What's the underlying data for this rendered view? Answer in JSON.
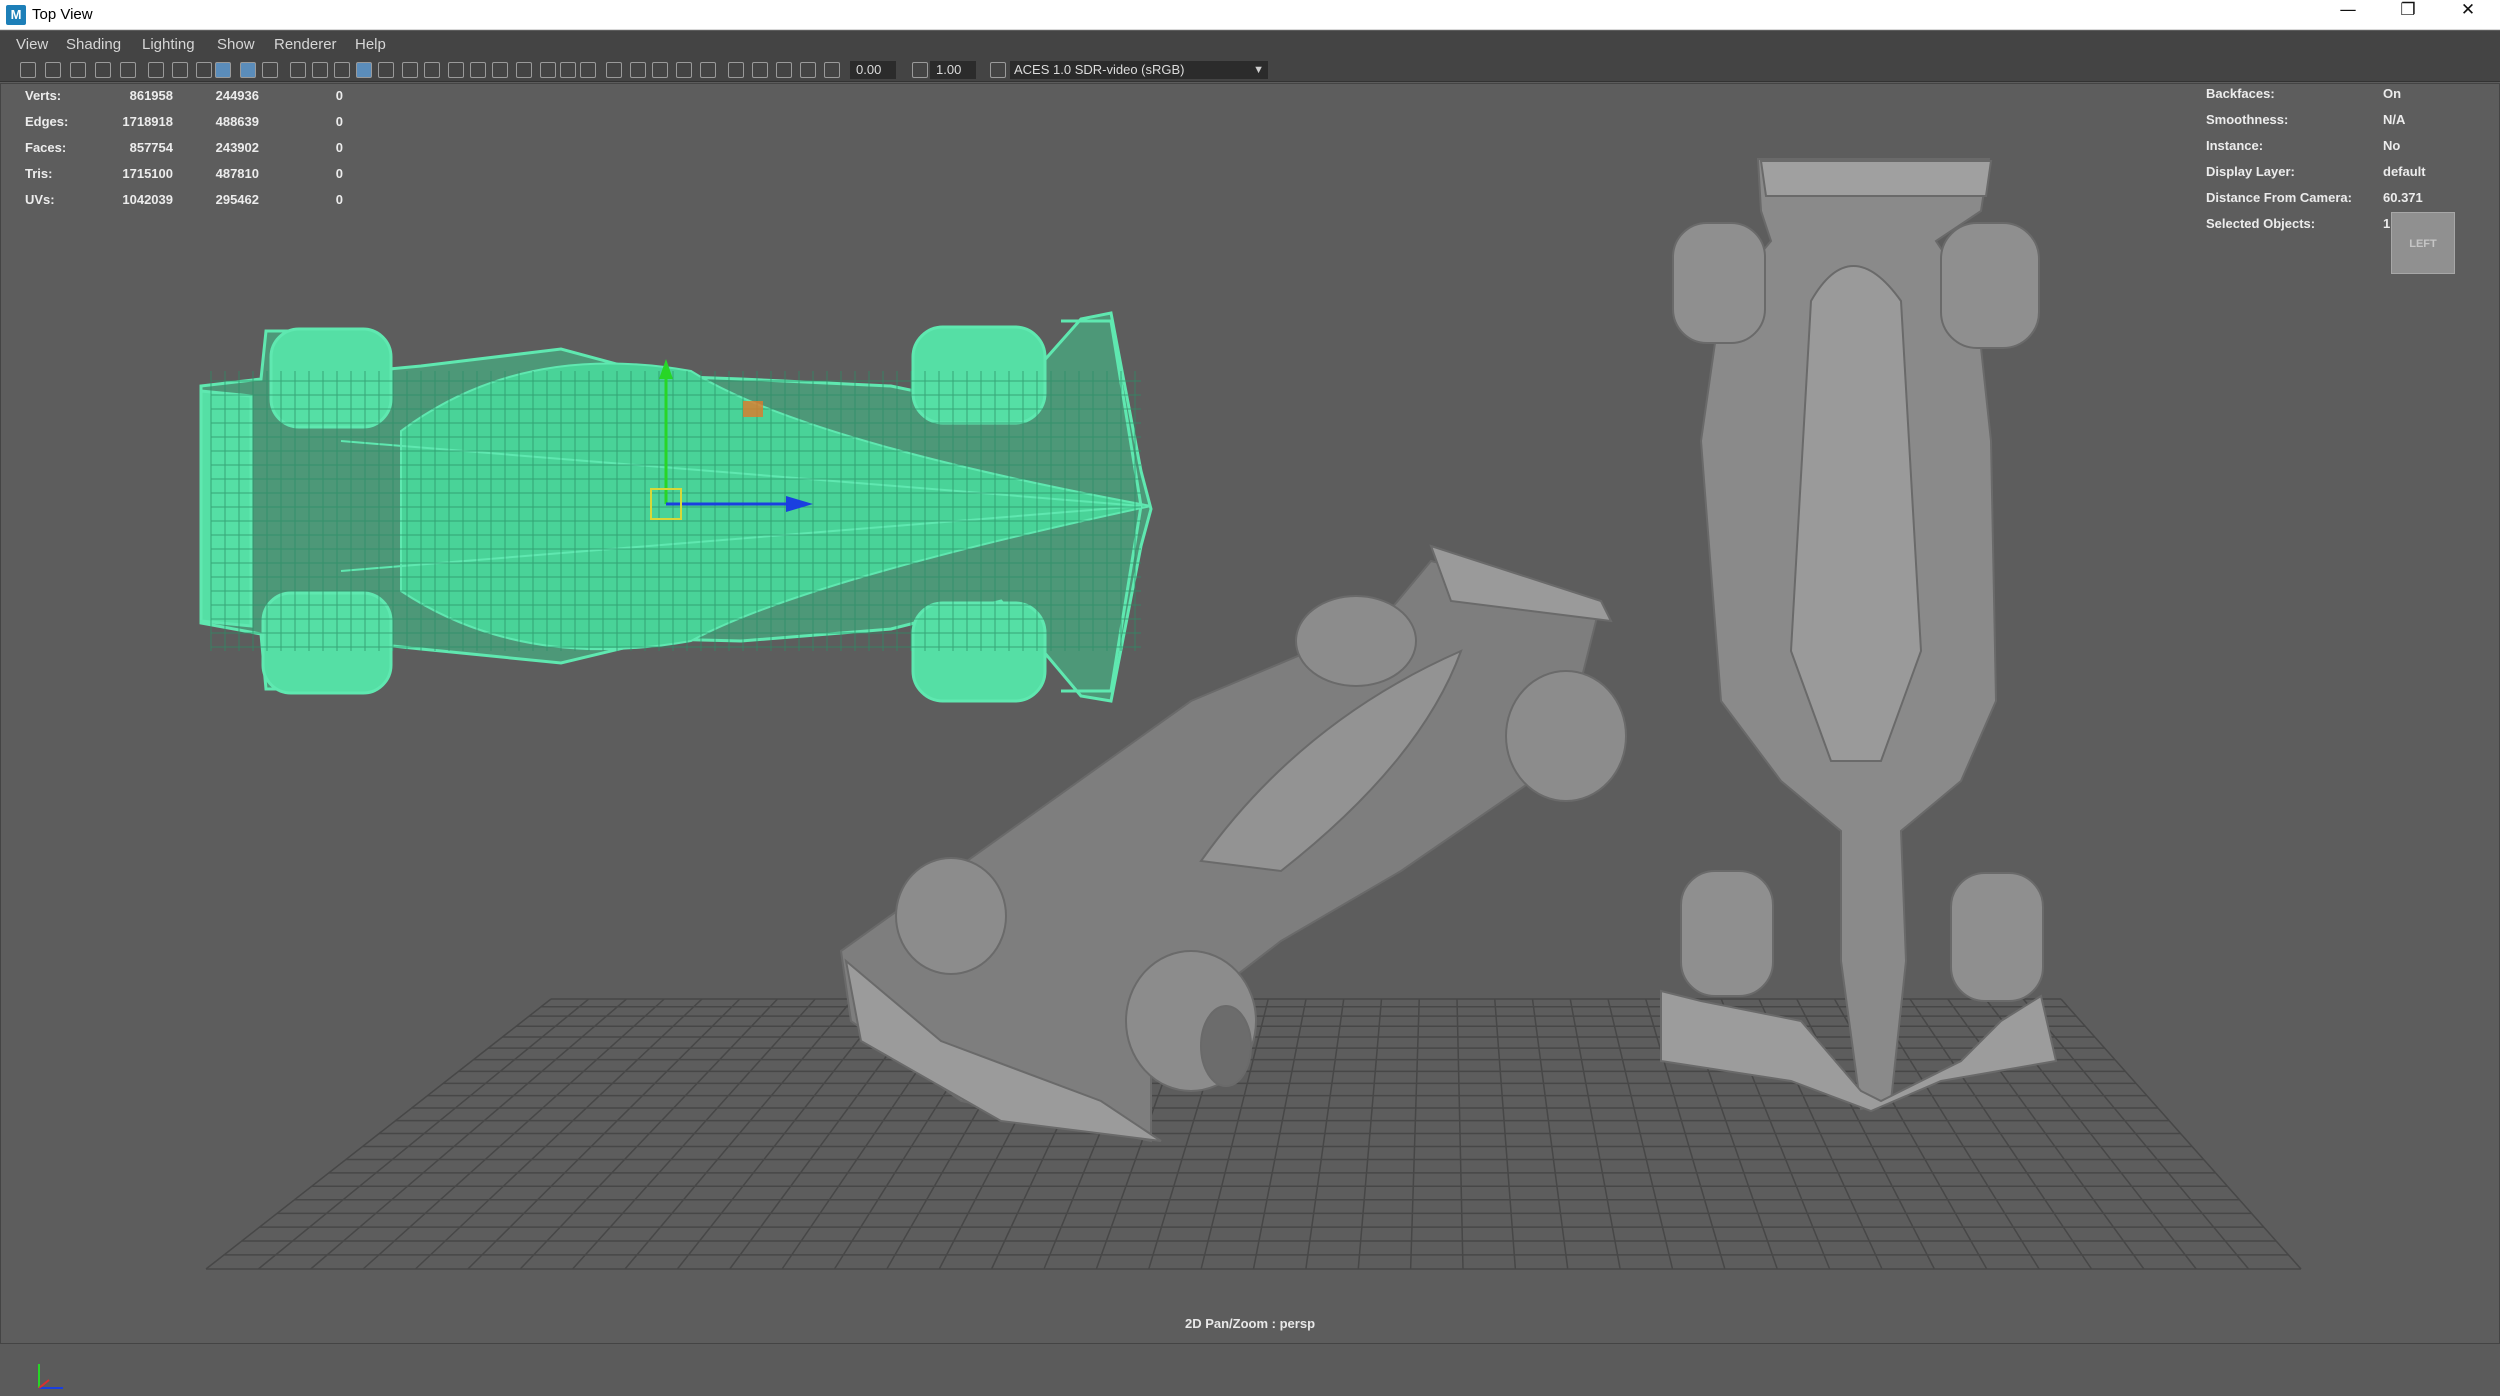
{
  "window": {
    "title": "Top View",
    "app_icon": "M",
    "minimize": "—",
    "restore": "❐",
    "close": "✕"
  },
  "menu": [
    "View",
    "Shading",
    "Lighting",
    "Show",
    "Renderer",
    "Help"
  ],
  "toolbar": {
    "exposure_value": "0.00",
    "gamma_value": "1.00",
    "color_space": "ACES 1.0 SDR-video (sRGB)",
    "icons": [
      "camera-icon",
      "camera-attr-icon",
      "bookmark-icon",
      "image-plane-icon",
      "grid-icon",
      "film-gate-icon",
      "resolution-gate-icon",
      "gate-mask-icon",
      "field-chart-icon",
      "safe-action-icon",
      "safe-title-icon",
      "wireframe-icon",
      "smooth-shade-icon",
      "default-material-icon",
      "textured-icon",
      "lights-icon",
      "shadows-icon",
      "ao-icon",
      "motion-blur-icon",
      "aa-icon",
      "isolate-icon",
      "xray-icon",
      "xray-joints-icon",
      "xray-components-icon",
      "exposure-icon",
      "gamma-icon",
      "colorspace-icon"
    ],
    "accent": "#5b8dbb"
  },
  "hud_left": {
    "rows": [
      {
        "label": "Verts:",
        "c1": "861958",
        "c2": "244936",
        "c3": "0"
      },
      {
        "label": "Edges:",
        "c1": "1718918",
        "c2": "488639",
        "c3": "0"
      },
      {
        "label": "Faces:",
        "c1": "857754",
        "c2": "243902",
        "c3": "0"
      },
      {
        "label": "Tris:",
        "c1": "1715100",
        "c2": "487810",
        "c3": "0"
      },
      {
        "label": "UVs:",
        "c1": "1042039",
        "c2": "295462",
        "c3": "0"
      }
    ]
  },
  "hud_right": {
    "rows": [
      {
        "label": "Backfaces:",
        "value": "On"
      },
      {
        "label": "Smoothness:",
        "value": "N/A"
      },
      {
        "label": "Instance:",
        "value": "No"
      },
      {
        "label": "Display Layer:",
        "value": "default"
      },
      {
        "label": "Distance From Camera:",
        "value": "60.371"
      },
      {
        "label": "Selected Objects:",
        "value": "1"
      }
    ]
  },
  "viewcube_label": "LEFT",
  "camera_label": "2D Pan/Zoom : persp",
  "colors": {
    "wireframe": "#5fe8b0",
    "model": "#8a8a8a",
    "grid": "#474747",
    "manip_y": "#27d627",
    "manip_x": "#1a3fe0"
  }
}
